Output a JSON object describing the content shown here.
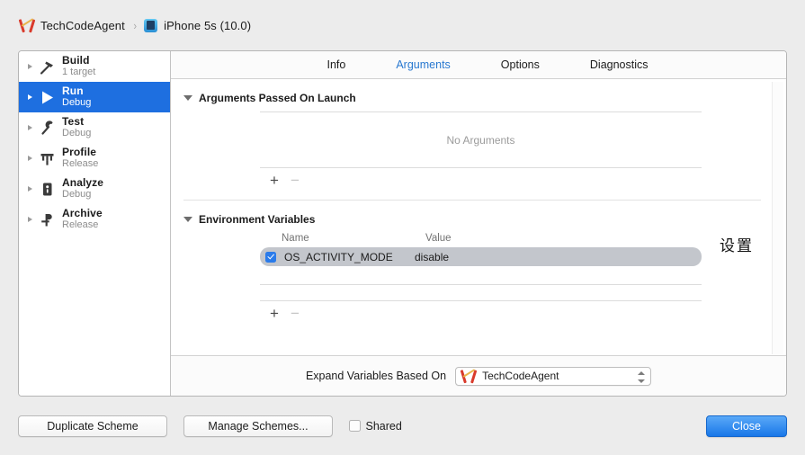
{
  "breadcrumb": {
    "project": "TechCodeAgent",
    "separator": "›",
    "destination": "iPhone 5s (10.0)",
    "project_icon": "xcode-icon",
    "device_icon": "iphone-simulator-icon"
  },
  "sidebar": {
    "items": [
      {
        "title": "Build",
        "subtitle": "1 target",
        "icon": "hammer-icon",
        "selected": false
      },
      {
        "title": "Run",
        "subtitle": "Debug",
        "icon": "play-icon",
        "selected": true
      },
      {
        "title": "Test",
        "subtitle": "Debug",
        "icon": "wrench-icon",
        "selected": false
      },
      {
        "title": "Profile",
        "subtitle": "Release",
        "icon": "gauge-icon",
        "selected": false
      },
      {
        "title": "Analyze",
        "subtitle": "Debug",
        "icon": "analyze-icon",
        "selected": false
      },
      {
        "title": "Archive",
        "subtitle": "Release",
        "icon": "archive-icon",
        "selected": false
      }
    ]
  },
  "tabs": [
    {
      "label": "Info",
      "active": false
    },
    {
      "label": "Arguments",
      "active": true
    },
    {
      "label": "Options",
      "active": false
    },
    {
      "label": "Diagnostics",
      "active": false
    }
  ],
  "arguments_section": {
    "title": "Arguments Passed On Launch",
    "empty_message": "No Arguments",
    "add_label": "+",
    "remove_label": "−"
  },
  "environment_section": {
    "title": "Environment Variables",
    "columns": {
      "name": "Name",
      "value": "Value"
    },
    "rows": [
      {
        "enabled": true,
        "name": "OS_ACTIVITY_MODE",
        "value": "disable",
        "selected": true
      }
    ],
    "add_label": "+",
    "remove_label": "−"
  },
  "annotation": {
    "text": "设置"
  },
  "expand_bar": {
    "label": "Expand Variables Based On",
    "selected_target": "TechCodeAgent",
    "target_icon": "xcode-icon"
  },
  "footer": {
    "duplicate_label": "Duplicate Scheme",
    "manage_label": "Manage Schemes...",
    "shared_label": "Shared",
    "shared_checked": false,
    "close_label": "Close"
  },
  "colors": {
    "selection_blue": "#1e6fe0",
    "tab_active_blue": "#2878d0",
    "checkbox_blue": "#2a7bea",
    "row_selected_gray": "#c3c6cc",
    "default_button_blue": "#1877e8"
  }
}
